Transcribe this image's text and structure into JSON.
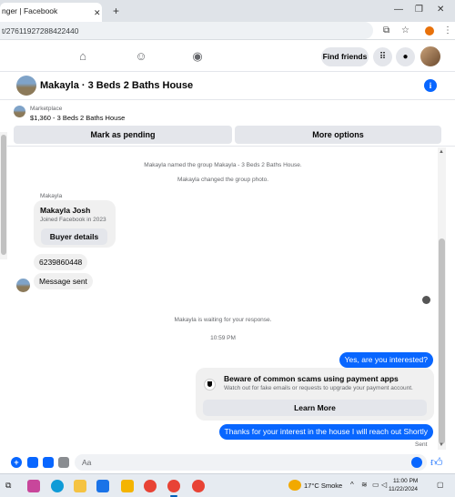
{
  "browser": {
    "tab_title": "nger | Facebook",
    "url": "t/27611927288422440",
    "colors": {
      "tabstrip": "#dfe3e8",
      "profile": "#e8710a"
    }
  },
  "fb_nav": {
    "find_friends": "Find friends",
    "icons": [
      "home-icon",
      "friends-icon",
      "gaming-icon",
      "menu-grid-icon",
      "bell-icon",
      "account-avatar"
    ]
  },
  "chat": {
    "title": "Makayla · 3 Beds 2 Baths House",
    "marketplace_label": "Marketplace",
    "listing": "$1,360 - 3 Beds 2 Baths House",
    "mark_pending": "Mark as pending",
    "more_options": "More options"
  },
  "messages": {
    "sys_named": "Makayla named the group Makayla - 3 Beds 2 Baths House.",
    "sys_photo": "Makayla changed the group photo.",
    "sender": "Makayla",
    "card_name": "Makayla Josh",
    "card_sub": "Joined Facebook in 2023",
    "buyer_details": "Buyer details",
    "phone": "6239860448",
    "msg_sent": "Message sent",
    "waiting": "Makayla is waiting for your response.",
    "time": "10:59 PM",
    "out_1": "Yes, are you interested?",
    "scam_title": "Beware of common scams using payment apps",
    "scam_sub": "Watch out for fake emails or requests to upgrade your payment account.",
    "learn_more": "Learn More",
    "out_2": "Thanks for your interest in the house I will reach out Shortly",
    "sent": "Sent"
  },
  "composer": {
    "placeholder": "Aa"
  },
  "taskbar": {
    "weather": "17°C Smoke",
    "time": "11:00 PM",
    "date": "11/22/2024"
  },
  "colors": {
    "accent": "#0866ff",
    "bubble_in": "#f0f0f0",
    "button_gray": "#e4e6eb",
    "secondary_text": "#65676b"
  }
}
